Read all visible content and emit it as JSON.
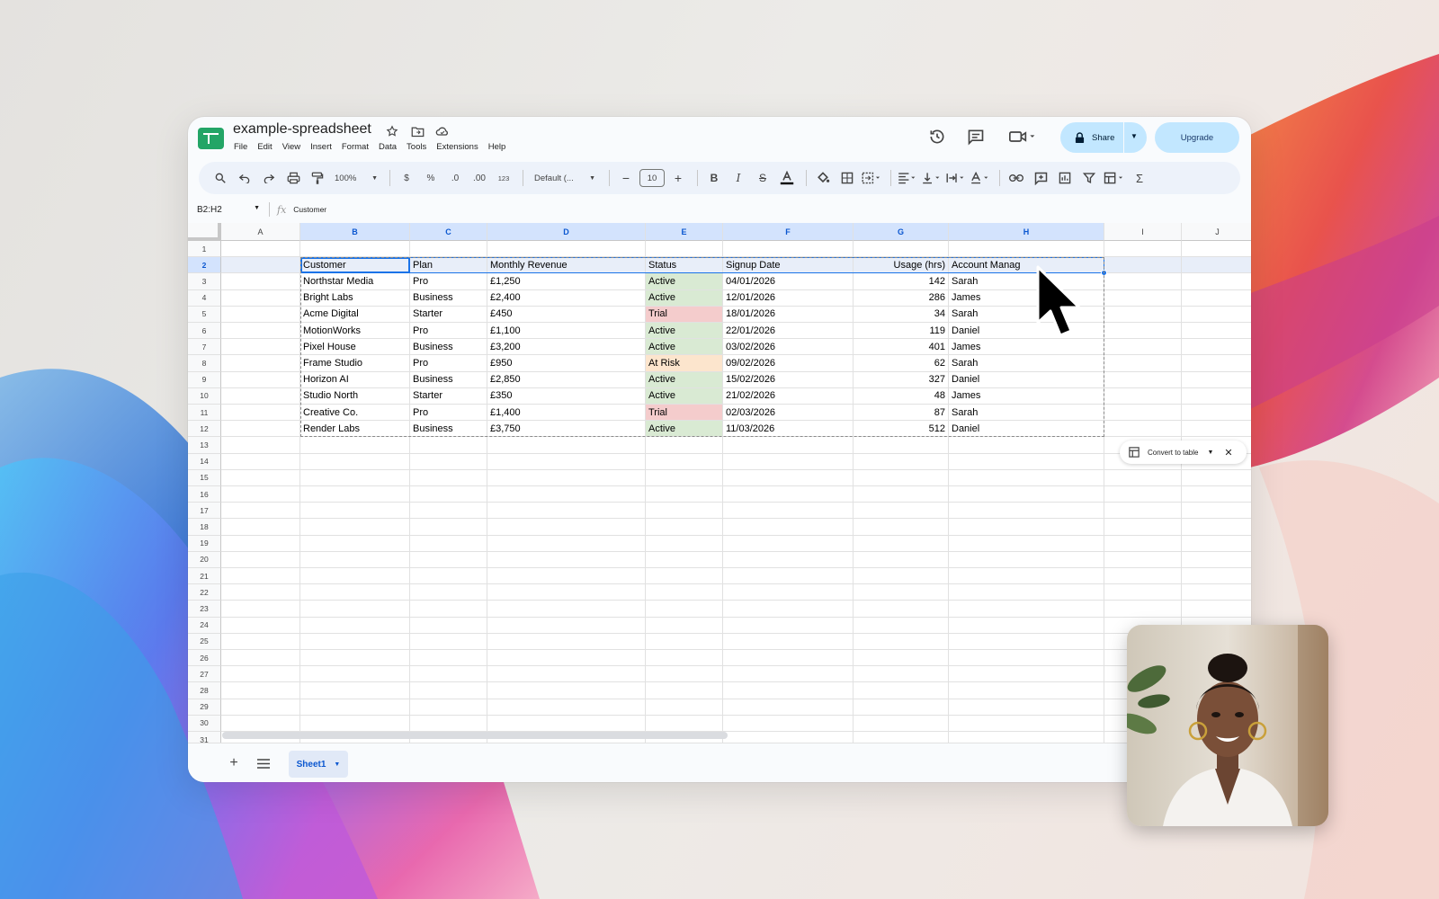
{
  "app": {
    "doc_title": "example-spreadsheet",
    "menu": [
      "File",
      "Edit",
      "View",
      "Insert",
      "Format",
      "Data",
      "Tools",
      "Extensions",
      "Help"
    ],
    "share_label": "Share",
    "upgrade_label": "Upgrade"
  },
  "toolbar": {
    "zoom": "100%",
    "currency": "$",
    "percent": "%",
    "dec_decrease": ".0",
    "dec_increase": ".00",
    "number_format": "123",
    "font": "Default (...",
    "font_size": "10"
  },
  "formula_bar": {
    "name_box": "B2:H2",
    "fx": "fx",
    "value": "Customer"
  },
  "grid": {
    "columns": [
      "A",
      "B",
      "C",
      "D",
      "E",
      "F",
      "G",
      "H",
      "I",
      "J"
    ],
    "row_numbers": [
      "1",
      "2",
      "3",
      "4",
      "5",
      "6",
      "7",
      "8",
      "9",
      "10",
      "11",
      "12",
      "13",
      "14",
      "15",
      "16",
      "17",
      "18",
      "19",
      "20",
      "21",
      "22",
      "23",
      "24",
      "25",
      "26",
      "27",
      "28",
      "29",
      "30",
      "31"
    ],
    "header": [
      "Customer",
      "Plan",
      "Monthly Revenue",
      "Status",
      "Signup Date",
      "Usage (hrs)",
      "Account Manag"
    ],
    "rows": [
      [
        "Northstar Media",
        "Pro",
        "£1,250",
        "Active",
        "04/01/2026",
        "142",
        "Sarah"
      ],
      [
        "Bright Labs",
        "Business",
        "£2,400",
        "Active",
        "12/01/2026",
        "286",
        "James"
      ],
      [
        "Acme Digital",
        "Starter",
        "£450",
        "Trial",
        "18/01/2026",
        "34",
        "Sarah"
      ],
      [
        "MotionWorks",
        "Pro",
        "£1,100",
        "Active",
        "22/01/2026",
        "119",
        "Daniel"
      ],
      [
        "Pixel House",
        "Business",
        "£3,200",
        "Active",
        "03/02/2026",
        "401",
        "James"
      ],
      [
        "Frame Studio",
        "Pro",
        "£950",
        "At Risk",
        "09/02/2026",
        "62",
        "Sarah"
      ],
      [
        "Horizon AI",
        "Business",
        "£2,850",
        "Active",
        "15/02/2026",
        "327",
        "Daniel"
      ],
      [
        "Studio North",
        "Starter",
        "£350",
        "Active",
        "21/02/2026",
        "48",
        "James"
      ],
      [
        "Creative Co.",
        "Pro",
        "£1,400",
        "Trial",
        "02/03/2026",
        "87",
        "Sarah"
      ],
      [
        "Render Labs",
        "Business",
        "£3,750",
        "Active",
        "11/03/2026",
        "512",
        "Daniel"
      ]
    ]
  },
  "convert_chip": {
    "label": "Convert to table"
  },
  "sheets": {
    "tabs": [
      "Sheet1"
    ]
  },
  "colors": {
    "status_active": "#d9ead3",
    "status_trial": "#f4cccc",
    "status_at_risk": "#fce5cd",
    "accent": "#1a73e8",
    "share_bg": "#c2e7ff"
  }
}
